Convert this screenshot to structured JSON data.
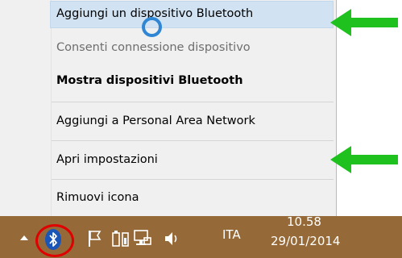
{
  "menu": {
    "items": [
      {
        "label": "Aggiungi un dispositivo Bluetooth"
      },
      {
        "label": "Consenti connessione dispositivo"
      },
      {
        "label": "Mostra dispositivi Bluetooth"
      },
      {
        "label": "Aggiungi a Personal Area Network"
      },
      {
        "label": "Apri impostazioni"
      },
      {
        "label": "Rimuovi icona"
      }
    ]
  },
  "taskbar": {
    "language": "ITA",
    "time": "10.58",
    "date": "29/01/2014"
  },
  "icons": [
    "chevron-up-icon",
    "bluetooth-icon",
    "action-center-flag-icon",
    "power-icon",
    "network-icon",
    "speaker-icon"
  ],
  "colors": {
    "highlight": "#d1e2f2",
    "annotation_arrow": "#1fc11f",
    "annotation_circle": "#e00000",
    "cursor_ring": "#2f86d4",
    "taskbar": "#956a38"
  }
}
